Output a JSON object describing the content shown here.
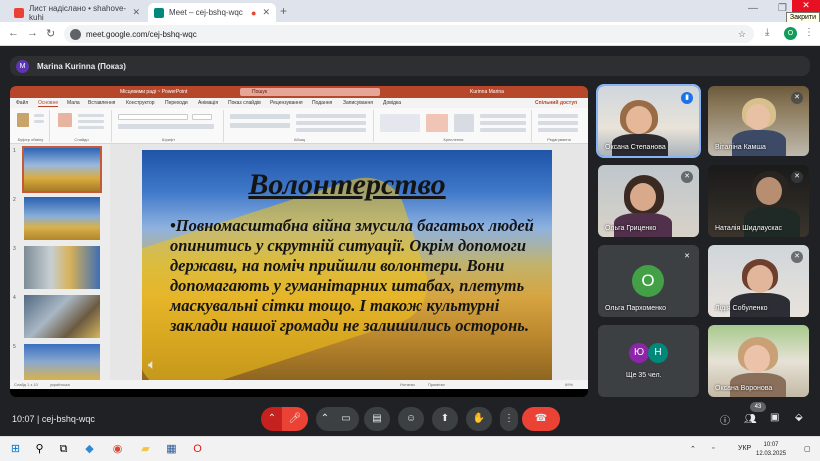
{
  "browser": {
    "tabs": [
      {
        "title": "Лист надіслано • shahove-kuhi"
      },
      {
        "title": "Meet – cej-bshq-wqc"
      }
    ],
    "url": "meet.google.com/cej-bshq-wqc",
    "close_tooltip": "Закрити",
    "profile_initial": "O"
  },
  "meet": {
    "presenter": {
      "initial": "M",
      "name": "Marina Kurinna (Показ)"
    },
    "meeting_code": "cej-bshq-wqc",
    "time": "10:07",
    "people_count": "43",
    "participants": [
      {
        "name": "Оксана Степанова"
      },
      {
        "name": "Віталіна Камша"
      },
      {
        "name": "Ольга Гриценко"
      },
      {
        "name": "Наталія Шидлаускас"
      },
      {
        "name": "Ольга Пархоменко",
        "initial": "О"
      },
      {
        "name": "Лідія Собуленко"
      },
      {
        "name": "Ще 35 чел.",
        "initials": [
          "Ю",
          "Н"
        ]
      },
      {
        "name": "Оксана Воронова"
      }
    ]
  },
  "powerpoint": {
    "file_name": "Місцевими радi  ~  PowerPoint",
    "search_placeholder": "Пошук",
    "user": "Kurinna Marina",
    "share": "Спільний доступ",
    "menu": [
      "Файл",
      "Основне",
      "Мала",
      "Вставлення",
      "Конструктор",
      "Переходи",
      "Анімація",
      "Показ слайдів",
      "Рецензування",
      "Подання",
      "Записування",
      "Довідка"
    ],
    "ribbon_groups": [
      "Буфер обміну",
      "Слайди",
      "Шрифт",
      "Абзац",
      "Креслення",
      "Редагування"
    ],
    "status": {
      "slide": "Слайд 1 з 10",
      "lang": "українська",
      "notes": "Нотатки",
      "comments": "Примітки",
      "zoom": "69%"
    },
    "slide": {
      "title": "Волонтерство",
      "body": "•Повномасштабна війна змусила багатьох людей опинитись у скрутній ситуації. Окрім допомоги держави, на поміч прийшли волонтери. Вони допомагають у гуманітарних штабах, плетуть маскувальні сітки тощо. І також культурні заклади нашої громади не залишились осторонь."
    },
    "thumbnail_numbers": [
      "1",
      "2",
      "3",
      "4",
      "5"
    ]
  },
  "taskbar": {
    "lang": "УКР",
    "time": "10:07",
    "date": "12.03.2025"
  },
  "colors": {
    "ppt_accent": "#b7472a",
    "meet_bg": "#202124",
    "end_call": "#ea4335",
    "mic_active": "#1a73e8"
  }
}
